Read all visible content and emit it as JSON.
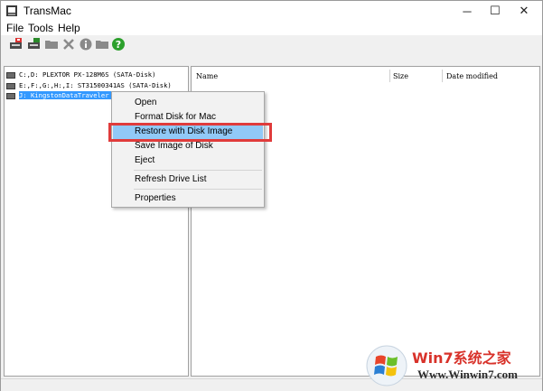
{
  "window": {
    "title": "TransMac",
    "min_symbol": "─",
    "max_symbol": "☐",
    "close_symbol": "✕"
  },
  "menu": {
    "items": [
      "File",
      "Tools",
      "Help"
    ]
  },
  "toolbar": {
    "icons": [
      "format-disk-icon",
      "open-disk-icon",
      "folder-icon",
      "delete-icon",
      "info-icon",
      "new-folder-icon",
      "help-icon"
    ]
  },
  "drives": [
    {
      "label": "C:,D: PLEXTOR PX-128M6S (SATA-Disk)"
    },
    {
      "label": "E:,F:,G:,H:,I: ST31500341AS (SATA-Disk)"
    },
    {
      "label": "J: KingstonDataTraveler 3.0 (USB-Disk)"
    }
  ],
  "file_list": {
    "columns": [
      "Name",
      "Size",
      "Date modified"
    ]
  },
  "context_menu": {
    "items": [
      "Open",
      "Format Disk for Mac",
      "Restore with Disk Image",
      "Save Image of Disk",
      "Eject",
      "Refresh Drive List",
      "Properties"
    ]
  },
  "watermark": {
    "brand": "Win7系统之家",
    "url": "Www.Winwin7.com"
  },
  "colors": {
    "selection": "#3399ff",
    "menu_hover": "#91c9f7",
    "annotation_box": "#e03b3b"
  }
}
